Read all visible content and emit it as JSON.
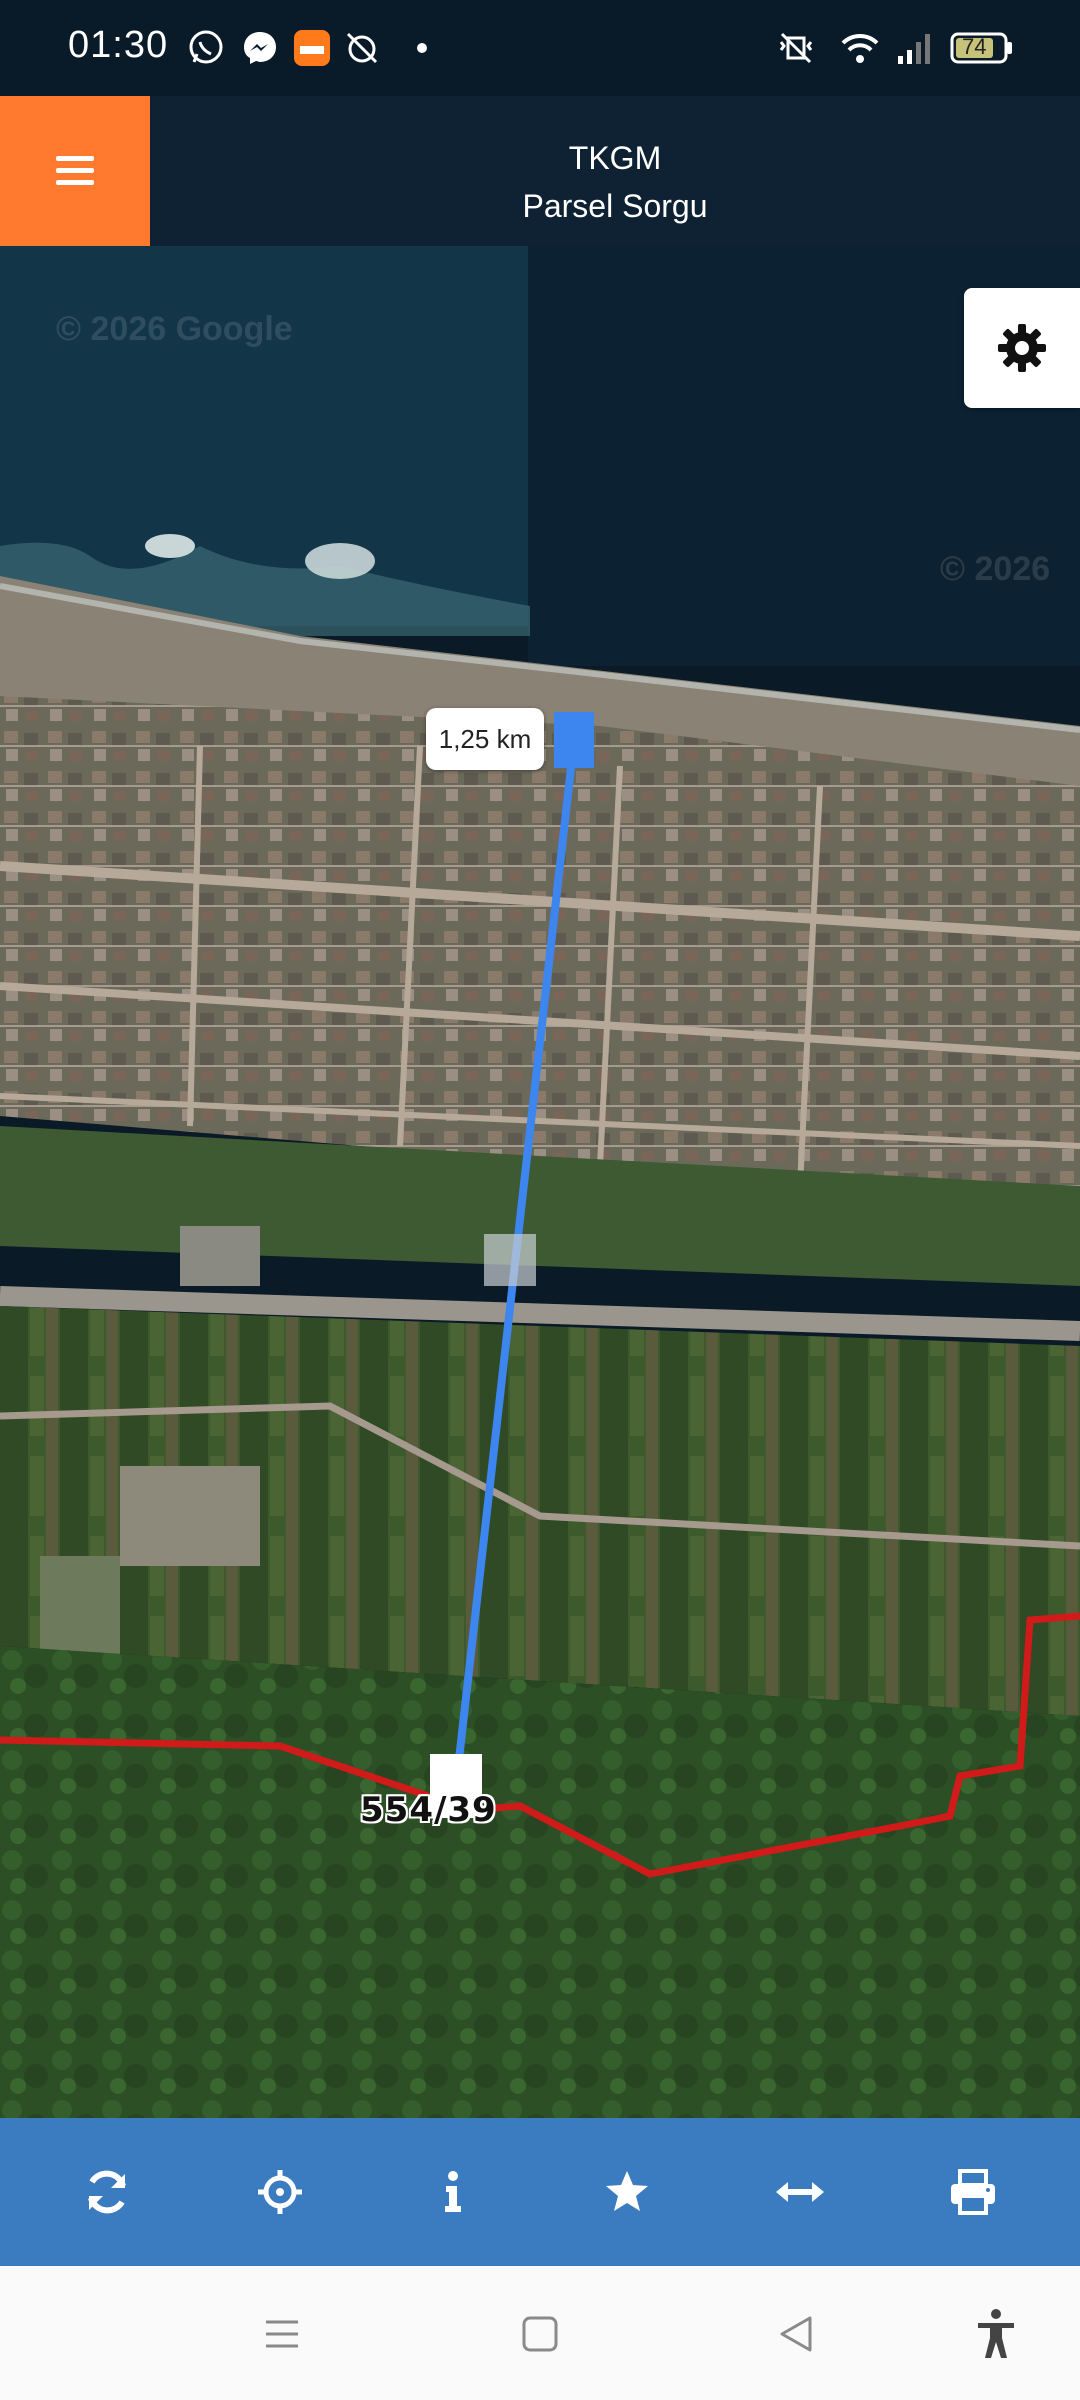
{
  "status_bar": {
    "time": "01:30",
    "battery": "74",
    "icons": [
      "whatsapp-icon",
      "messenger-icon",
      "temu-icon",
      "alarm-off-icon",
      "dot-icon",
      "vibrate-icon",
      "wifi-icon",
      "signal-icon",
      "battery-icon"
    ]
  },
  "app": {
    "title_line1": "TKGM",
    "title_line2": "Parsel Sorgu"
  },
  "map": {
    "watermark_left": "© 2026 Google",
    "watermark_right": "© 2026",
    "measure_distance": "1,25 km",
    "parcel_label": "554/39",
    "colors": {
      "measure_line": "#3d86f0",
      "parcel_border": "#d11a1a",
      "sea": "#0e2a3c"
    }
  },
  "toolbar": {
    "items": [
      "refresh-icon",
      "locate-icon",
      "info-icon",
      "favorite-icon",
      "measure-icon",
      "print-icon"
    ]
  },
  "navbar": {
    "items": [
      "recents-icon",
      "home-icon",
      "back-icon",
      "accessibility-icon"
    ]
  }
}
